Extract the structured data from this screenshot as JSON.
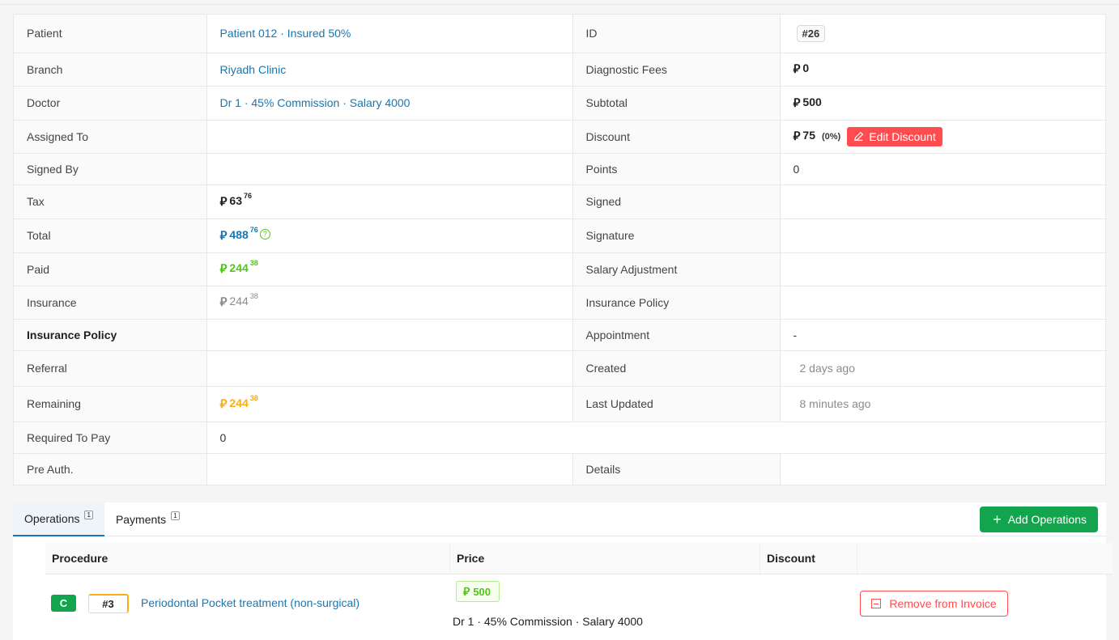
{
  "currency_symbol": "⃁",
  "info": {
    "rows": [
      {
        "l1": "Patient",
        "v1": "Patient 012 · Insured 50%",
        "l2": "ID",
        "v2": "#26"
      },
      {
        "l1": "Branch",
        "v1": "Riyadh Clinic",
        "l2": "Diagnostic Fees",
        "v2": "0"
      },
      {
        "l1": "Doctor",
        "v1": "Dr 1 · 45% Commission · Salary 4000",
        "l2": "Subtotal",
        "v2": "500"
      },
      {
        "l1": "Assigned To",
        "v1": "",
        "l2": "Discount",
        "v2": "75",
        "v2_pct": "(0%)",
        "v2_btn": "Edit Discount"
      },
      {
        "l1": "Signed By",
        "v1": "",
        "l2": "Points",
        "v2": "0"
      },
      {
        "l1": "Tax",
        "v1_int": "63",
        "v1_dec": "76",
        "l2": "Signed",
        "v2": ""
      },
      {
        "l1": "Total",
        "v1_int": "488",
        "v1_dec": "76",
        "l2": "Signature",
        "v2": ""
      },
      {
        "l1": "Paid",
        "v1_int": "244",
        "v1_dec": "38",
        "l2": "Salary Adjustment",
        "v2": ""
      },
      {
        "l1": "Insurance",
        "v1_int": "244",
        "v1_dec": "38",
        "l2": "Insurance Policy",
        "v2": ""
      },
      {
        "l1": "Insurance Policy",
        "v1": "",
        "l2": "Appointment",
        "v2": "-"
      },
      {
        "l1": "Referral",
        "v1": "",
        "l2": "Created",
        "v2": "2 days ago"
      },
      {
        "l1": "Remaining",
        "v1_int": "244",
        "v1_dec": "38",
        "l2": "Last Updated",
        "v2": "8 minutes ago"
      },
      {
        "l1": "Required To Pay",
        "v1": "0"
      },
      {
        "l1": "Pre Auth.",
        "v1": "",
        "l2": "Details",
        "v2": ""
      }
    ]
  },
  "tabs": [
    {
      "label": "Operations",
      "count": "1"
    },
    {
      "label": "Payments",
      "count": "1"
    }
  ],
  "add_operations_label": "Add Operations",
  "ops_table": {
    "headers": [
      "Procedure",
      "Price",
      "Discount"
    ],
    "rows": [
      {
        "badge": "C",
        "tooth": "#3",
        "procedure": "Periodontal Pocket treatment (non-surgical)",
        "price": "500",
        "doctor": "Dr 1 · 45% Commission · Salary 4000",
        "action": "Remove from Invoice"
      }
    ]
  },
  "colors": {
    "link": "#1677b3",
    "paid": "#52c41a",
    "remaining": "#faad14",
    "danger": "#ff4d4f",
    "primary_green": "#13a54e"
  }
}
